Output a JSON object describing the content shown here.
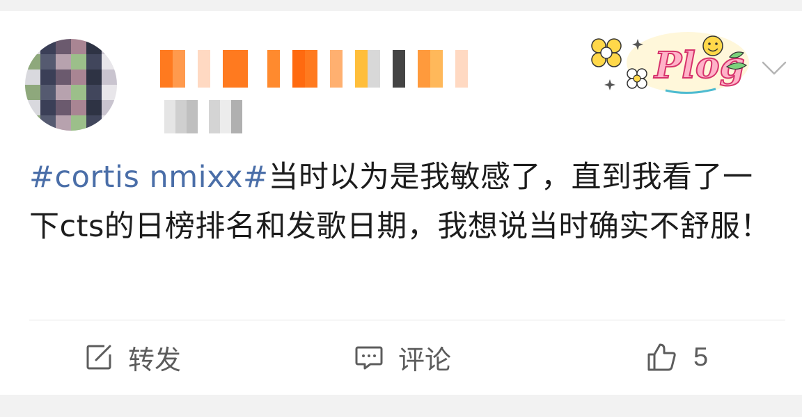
{
  "post": {
    "hashtag": "#cortis nmixx#",
    "text": "当时以为是我敏感了，直到我看了一下cts的日榜排名和发歌日期，我想说当时确实不舒服！"
  },
  "sticker": {
    "text": "Plog"
  },
  "actions": {
    "repost_label": "转发",
    "comment_label": "评论",
    "like_count": "5"
  },
  "colors": {
    "hashtag": "#4a6ea8",
    "text": "#1c1c1c",
    "action": "#5c5c5c",
    "background": "#f2f2f2",
    "card": "#ffffff"
  },
  "icons": {
    "repost": "edit-share-icon",
    "comment": "comment-icon",
    "like": "thumbs-up-icon",
    "menu": "chevron-down-icon"
  }
}
